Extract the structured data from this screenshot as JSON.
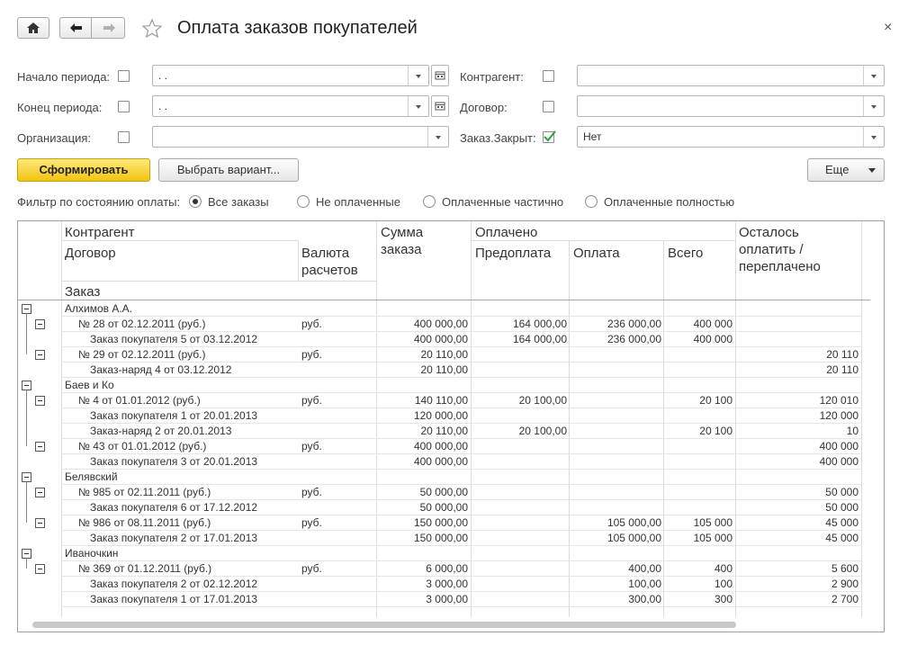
{
  "header": {
    "title": "Оплата заказов покупателей",
    "close": "×"
  },
  "filters": {
    "period_start_label": "Начало периода:",
    "period_end_label": "Конец периода:",
    "organization_label": "Организация:",
    "counterparty_label": "Контрагент:",
    "contract_label": "Договор:",
    "order_closed_label": "Заказ.Закрыт:",
    "period_start_value": ". .",
    "period_end_value": ". .",
    "order_closed_value": "Нет"
  },
  "toolbar": {
    "generate": "Сформировать",
    "variant": "Выбрать вариант...",
    "more": "Еще"
  },
  "payment_filter": {
    "label": "Фильтр по состоянию оплаты:",
    "options": [
      "Все заказы",
      "Не оплаченные",
      "Оплаченные частично",
      "Оплаченные полностью"
    ],
    "selected": 0
  },
  "table": {
    "headers": {
      "counterparty": "Контрагент",
      "contract": "Договор",
      "order": "Заказ",
      "currency": "Валюта расчетов",
      "amount": "Сумма заказа",
      "paid": "Оплачено",
      "prepay": "Предоплата",
      "payment": "Оплата",
      "total": "Всего",
      "remain": "Осталось оплатить / переплачено"
    },
    "rows": [
      {
        "level": 0,
        "name": "Алхимов А.А.",
        "cur": "",
        "amount": "",
        "prepay": "",
        "pay": "",
        "total": "",
        "remain": ""
      },
      {
        "level": 1,
        "name": "№ 28 от 02.12.2011 (руб.)",
        "cur": "руб.",
        "amount": "400 000,00",
        "prepay": "164 000,00",
        "pay": "236 000,00",
        "total": "400 000",
        "remain": ""
      },
      {
        "level": 2,
        "name": "Заказ покупателя 5 от 03.12.2012",
        "cur": "",
        "amount": "400 000,00",
        "prepay": "164 000,00",
        "pay": "236 000,00",
        "total": "400 000",
        "remain": ""
      },
      {
        "level": 1,
        "name": "№ 29 от 02.12.2011 (руб.)",
        "cur": "руб.",
        "amount": "20 110,00",
        "prepay": "",
        "pay": "",
        "total": "",
        "remain": "20 110"
      },
      {
        "level": 2,
        "name": "Заказ-наряд 4 от 03.12.2012",
        "cur": "",
        "amount": "20 110,00",
        "prepay": "",
        "pay": "",
        "total": "",
        "remain": "20 110"
      },
      {
        "level": 0,
        "name": "Баев и Ко",
        "cur": "",
        "amount": "",
        "prepay": "",
        "pay": "",
        "total": "",
        "remain": ""
      },
      {
        "level": 1,
        "name": "№ 4 от 01.01.2012 (руб.)",
        "cur": "руб.",
        "amount": "140 110,00",
        "prepay": "20 100,00",
        "pay": "",
        "total": "20 100",
        "remain": "120 010"
      },
      {
        "level": 2,
        "name": "Заказ покупателя 1 от 20.01.2013",
        "cur": "",
        "amount": "120 000,00",
        "prepay": "",
        "pay": "",
        "total": "",
        "remain": "120 000"
      },
      {
        "level": 2,
        "name": "Заказ-наряд 2 от 20.01.2013",
        "cur": "",
        "amount": "20 110,00",
        "prepay": "20 100,00",
        "pay": "",
        "total": "20 100",
        "remain": "10"
      },
      {
        "level": 1,
        "name": "№ 43 от 01.01.2012 (руб.)",
        "cur": "руб.",
        "amount": "400 000,00",
        "prepay": "",
        "pay": "",
        "total": "",
        "remain": "400 000"
      },
      {
        "level": 2,
        "name": "Заказ покупателя 3 от 20.01.2013",
        "cur": "",
        "amount": "400 000,00",
        "prepay": "",
        "pay": "",
        "total": "",
        "remain": "400 000"
      },
      {
        "level": 0,
        "name": "Белявский",
        "cur": "",
        "amount": "",
        "prepay": "",
        "pay": "",
        "total": "",
        "remain": ""
      },
      {
        "level": 1,
        "name": "№ 985 от 02.11.2011 (руб.)",
        "cur": "руб.",
        "amount": "50 000,00",
        "prepay": "",
        "pay": "",
        "total": "",
        "remain": "50 000"
      },
      {
        "level": 2,
        "name": "Заказ покупателя 6 от 17.12.2012",
        "cur": "",
        "amount": "50 000,00",
        "prepay": "",
        "pay": "",
        "total": "",
        "remain": "50 000"
      },
      {
        "level": 1,
        "name": "№ 986 от 08.11.2011 (руб.)",
        "cur": "руб.",
        "amount": "150 000,00",
        "prepay": "",
        "pay": "105 000,00",
        "total": "105 000",
        "remain": "45 000"
      },
      {
        "level": 2,
        "name": "Заказ покупателя 2 от 17.01.2013",
        "cur": "",
        "amount": "150 000,00",
        "prepay": "",
        "pay": "105 000,00",
        "total": "105 000",
        "remain": "45 000"
      },
      {
        "level": 0,
        "name": "Иваночкин",
        "cur": "",
        "amount": "",
        "prepay": "",
        "pay": "",
        "total": "",
        "remain": ""
      },
      {
        "level": 1,
        "name": "№ 369 от 01.12.2011 (руб.)",
        "cur": "руб.",
        "amount": "6 000,00",
        "prepay": "",
        "pay": "400,00",
        "total": "400",
        "remain": "5 600"
      },
      {
        "level": 2,
        "name": "Заказ покупателя 2 от 02.12.2012",
        "cur": "",
        "amount": "3 000,00",
        "prepay": "",
        "pay": "100,00",
        "total": "100",
        "remain": "2 900"
      },
      {
        "level": 2,
        "name": "Заказ покупателя 1 от 17.01.2013",
        "cur": "",
        "amount": "3 000,00",
        "prepay": "",
        "pay": "300,00",
        "total": "300",
        "remain": "2 700"
      }
    ]
  }
}
